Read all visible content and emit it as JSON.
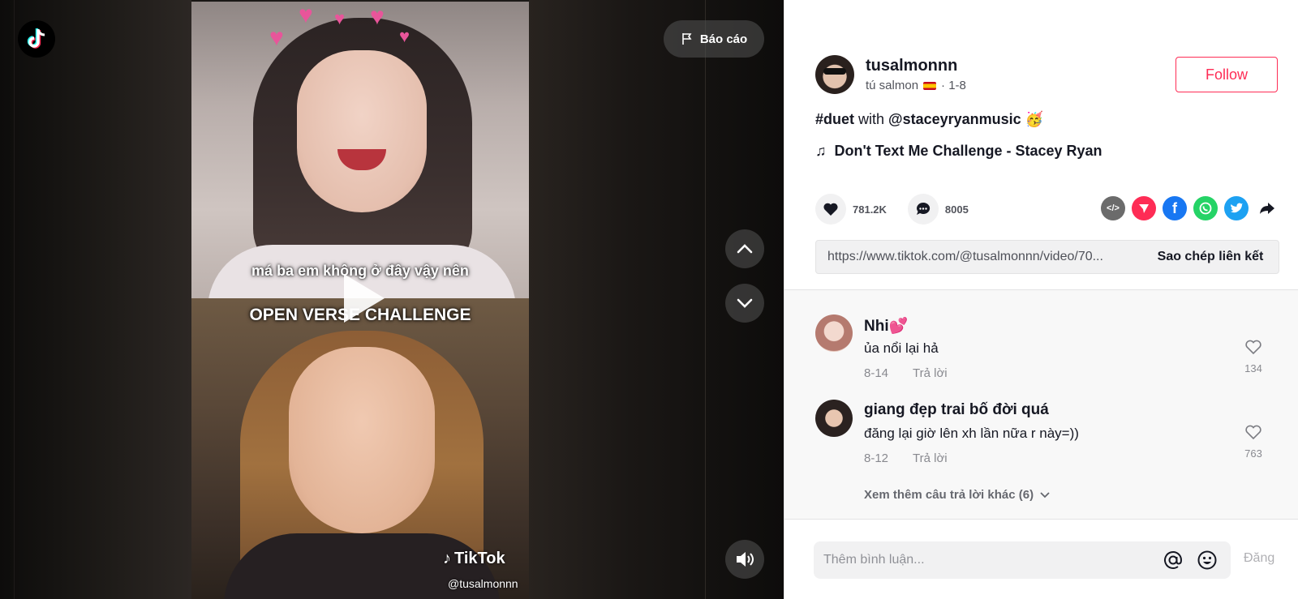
{
  "video": {
    "report_label": "Báo cáo",
    "caption_line1": "má ba em không ở đây vậy nên",
    "caption_line2": "OPEN VERSE CHALLENGE",
    "watermark": "TikTok",
    "watermark_handle": "@tusalmonnn"
  },
  "author": {
    "username": "tusalmonnn",
    "display_name": "tú salmon",
    "date": "· 1-8",
    "follow_label": "Follow"
  },
  "description": {
    "hashtag": "#duet",
    "with_text": " with ",
    "mention": "@staceyryanmusic",
    "emoji": "🥳"
  },
  "music": {
    "title": "Don't Text Me Challenge - Stacey Ryan"
  },
  "stats": {
    "likes": "781.2K",
    "comments": "8005"
  },
  "share_icons": [
    "embed-icon",
    "send-icon",
    "facebook-icon",
    "whatsapp-icon",
    "twitter-icon",
    "share-arrow-icon"
  ],
  "link": {
    "url": "https://www.tiktok.com/@tusalmonnn/video/70...",
    "copy_label": "Sao chép liên kết"
  },
  "comments": [
    {
      "name": "Nhi💕",
      "text": "ủa nổi lại hả",
      "date": "8-14",
      "reply_label": "Trả lời",
      "likes": "134"
    },
    {
      "name": "giang đẹp trai bố đời quá",
      "text": "đăng lại giờ lên xh lần nữa r này=))",
      "date": "8-12",
      "reply_label": "Trả lời",
      "likes": "763"
    }
  ],
  "more_replies": "Xem thêm câu trả lời khác (6)",
  "comment_input": {
    "placeholder": "Thêm bình luận...",
    "post_label": "Đăng"
  },
  "colors": {
    "accent": "#fe2c55",
    "facebook": "#1877f2",
    "whatsapp": "#25d366",
    "twitter": "#1da1f2",
    "send": "#fe2c55",
    "embed": "#6b6b6b"
  }
}
